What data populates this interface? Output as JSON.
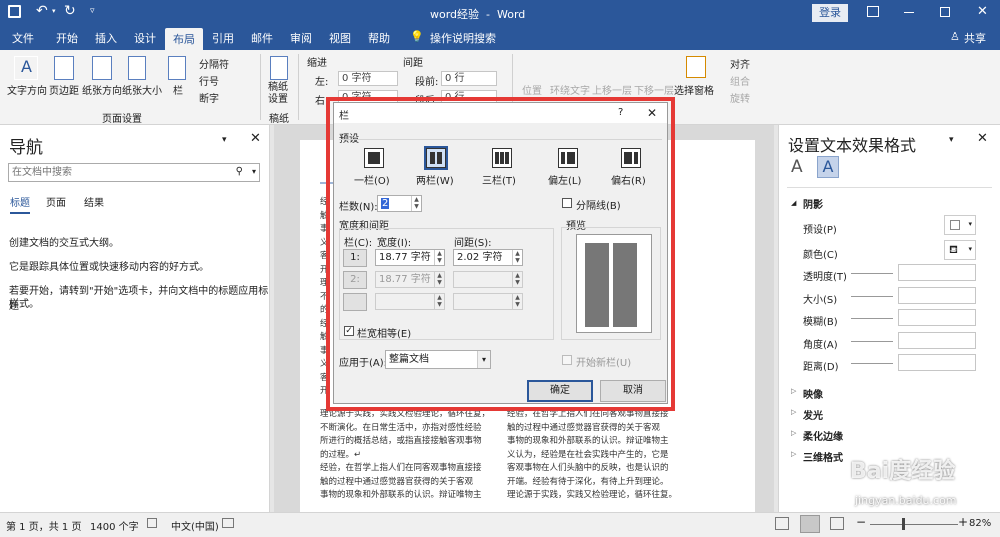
{
  "titlebar": {
    "title": "word经验  -  Word",
    "login": "登录"
  },
  "tabs": [
    "文件",
    "开始",
    "插入",
    "设计",
    "布局",
    "引用",
    "邮件",
    "审阅",
    "视图",
    "帮助",
    "操作说明搜索"
  ],
  "share": "共享",
  "ribbon": {
    "text_direction": "文字方向",
    "margins": "页边距",
    "orientation": "纸张方向",
    "size": "纸张大小",
    "columns": "栏",
    "breaks": "分隔符",
    "line_numbers": "行号",
    "hyphenation": "断字",
    "page_setup": "页面设置",
    "draft": "稿纸\n设置",
    "draft_group": "稿纸",
    "indent": "缩进",
    "spacing": "间距",
    "left": "左:",
    "right": "右:",
    "before": "段前:",
    "after": "段后:",
    "left_val": "0 字符",
    "right_val": "0 字符",
    "before_val": "0 行",
    "after_val": "0 行",
    "position": "位置",
    "wrap": "环绕文字",
    "bring_forward": "上移一层",
    "send_backward": "下移一层",
    "selection_pane": "选择窗格",
    "align": "对齐",
    "group": "组合",
    "rotate": "旋转"
  },
  "nav": {
    "title": "导航",
    "search_placeholder": "在文档中搜索",
    "tabs": [
      "标题",
      "页面",
      "结果"
    ],
    "p1": "创建文档的交互式大纲。",
    "p2": "它是跟踪具体位置或快速移动内容的好方式。",
    "p3a": "若要开始，请转到\"开始\"选项卡，并向文档中的标题应用标题",
    "p3b": "样式。"
  },
  "doc": {
    "left_col_chars": [
      "经",
      "触",
      "事",
      "义",
      "客",
      "开",
      "理",
      "不",
      "的",
      "经",
      "触",
      "事",
      "义",
      "客",
      "开"
    ],
    "left_lines": [
      "理论源于实践，实践又检验理论，循环往复，",
      "不断演化。在日常生活中，亦指对感性经验",
      "所进行的概括总结，或指直接接触客观事物",
      "的过程。↵",
      "经验，在哲学上指人们在同客观事物直接接",
      "触的过程中通过感觉器官获得的关于客观",
      "事物的现象和外部联系的认识。辩证唯物主"
    ],
    "right_lines": [
      "经验，在哲学上指人们在同客观事物直接接",
      "触的过程中通过感觉器官获得的关于客观",
      "事物的现象和外部联系的认识。辩证唯物主",
      "义认为，经验是在社会实践中产生的，它是",
      "客观事物在人们头脑中的反映，也是认识的",
      "开端。经验有待于深化，有待上升到理论。",
      "理论源于实践，实践又检验理论，循环往复。"
    ]
  },
  "fmt": {
    "title": "设置文本效果格式",
    "shadow": "阴影",
    "preset": "预设(P)",
    "color": "颜色(C)",
    "transparency": "透明度(T)",
    "size": "大小(S)",
    "blur": "模糊(B)",
    "angle": "角度(A)",
    "distance": "距离(D)",
    "reflection": "映像",
    "glow": "发光",
    "soft_edges": "柔化边缘",
    "three_d": "三维格式"
  },
  "status": {
    "page": "第 1 页，共 1 页",
    "words": "1400 个字",
    "lang": "中文(中国)",
    "zoom": "82%"
  },
  "dialog": {
    "title": "栏",
    "help": "?",
    "close": "✕",
    "presets_label": "预设",
    "presets": [
      "一栏(O)",
      "两栏(W)",
      "三栏(T)",
      "偏左(L)",
      "偏右(R)"
    ],
    "num_cols_label": "栏数(N):",
    "num_cols": "2",
    "line_between": "分隔线(B)",
    "width_spacing": "宽度和间距",
    "preview": "预览",
    "col_hdr": "栏(C):",
    "width_hdr": "宽度(I):",
    "spacing_hdr": "间距(S):",
    "row1_col": "1:",
    "row1_width": "18.77 字符",
    "row1_spacing": "2.02 字符",
    "row2_col": "2:",
    "row2_width": "18.77 字符",
    "equal_width": "栏宽相等(E)",
    "apply_label": "应用于(A):",
    "apply_value": "整篇文档",
    "start_new": "开始新栏(U)",
    "ok": "确定",
    "cancel": "取消"
  },
  "watermark": {
    "site": "Bai度经验",
    "url": "jingyan.baidu.com"
  },
  "colors": {
    "accent": "#2b579a",
    "red": "#e53935"
  }
}
